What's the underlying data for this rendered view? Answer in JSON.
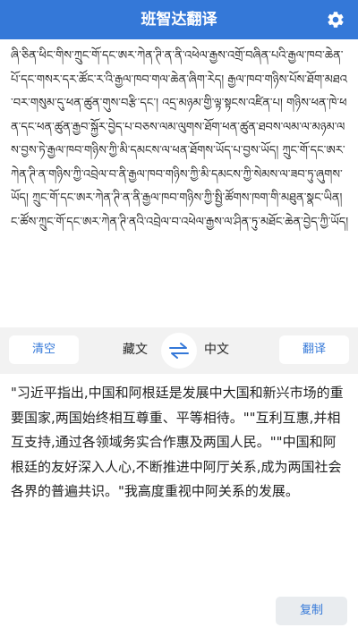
{
  "header": {
    "title": "班智达翻译",
    "settings_icon": "gear-icon",
    "background_color": "#3478d8"
  },
  "source": {
    "text": "ཞི་ཅིན་ཕིང་གིས་ཀྲུང་གོ་དང་ཨར་ཀེན་ཊི་ན་ནི་འཕེལ་རྒྱས་འགྲོ་བཞིན་པའི་རྒྱལ་ཁབ་ཆེན་པོ་དང་གསར་དར་ཚོང་ར་འི་རྒྱལ་ཁབ་གལ་ཆེན་ཞིག་རེད། རྒྱལ་ཁབ་གཉིས་པོས་ཐོག་མཐའ་བར་གསུམ་དུ་ཕན་ཚུན་གུས་བརྩི་དང་། འདྲ་མཉམ་གྱི་ལྟ་སྟངས་འཛིན་པ། གཉིས་ཕན་ཁེ་ཕན་དང་ཕན་ཚུན་རྒྱབ་སྐྱོར་བྱེད་པ་བཅས་ལམ་ལུགས་ཐོག་ཕན་ཚུན་ཐབས་ལམ་ལ་མཉམ་ལས་བྱས་ཏེ་རྒྱལ་ཁབ་གཉིས་ཀྱི་མི་དམངས་ལ་ཕན་ཐོགས་ཡོད་པ་བྱས་ཡོད། ཀྲུང་གོ་དང་ཨར་ཀེན་ཊི་ན་གཉིས་ཀྱི་འབྲེལ་བ་ནི་རྒྱལ་ཁབ་གཉིས་ཀྱི་མི་དམངས་ཀྱི་སེམས་ལ་ཟབ་ཏུ་ཞུགས་ཡོད། ཀྲུང་གོ་དང་ཨར་ཀེན་ཊི་ན་ནི་རྒྱལ་ཁབ་གཉིས་ཀྱི་སྤྱི་ཚོགས་ཁག་གི་མཐུན་སྣང་ཡིན། ང་ཚོས་ཀྲུང་གོ་དང་ཨར་ཀེན་ཊི་ནའི་འབྲེལ་བ་འཕེལ་རྒྱས་ལ་ཤིན་ཏུ་མཐོང་ཆེན་བྱེད་ཀྱི་ཡོད།"
  },
  "toolbar": {
    "clear_label": "清空",
    "source_lang": "藏文",
    "target_lang": "中文",
    "swap_icon": "swap-arrows-icon",
    "translate_label": "翻译"
  },
  "result": {
    "text": "\"习近平指出,中国和阿根廷是发展中大国和新兴市场的重要国家,两国始终相互尊重、平等相待。\"\"互利互惠,并相互支持,通过各领域务实合作惠及两国人民。\"\"中国和阿根廷的友好深入人心,不断推进中阿厅关系,成为两国社会各界的普遍共识。\"我高度重视中阿关系的发展。",
    "copy_label": "复制"
  }
}
